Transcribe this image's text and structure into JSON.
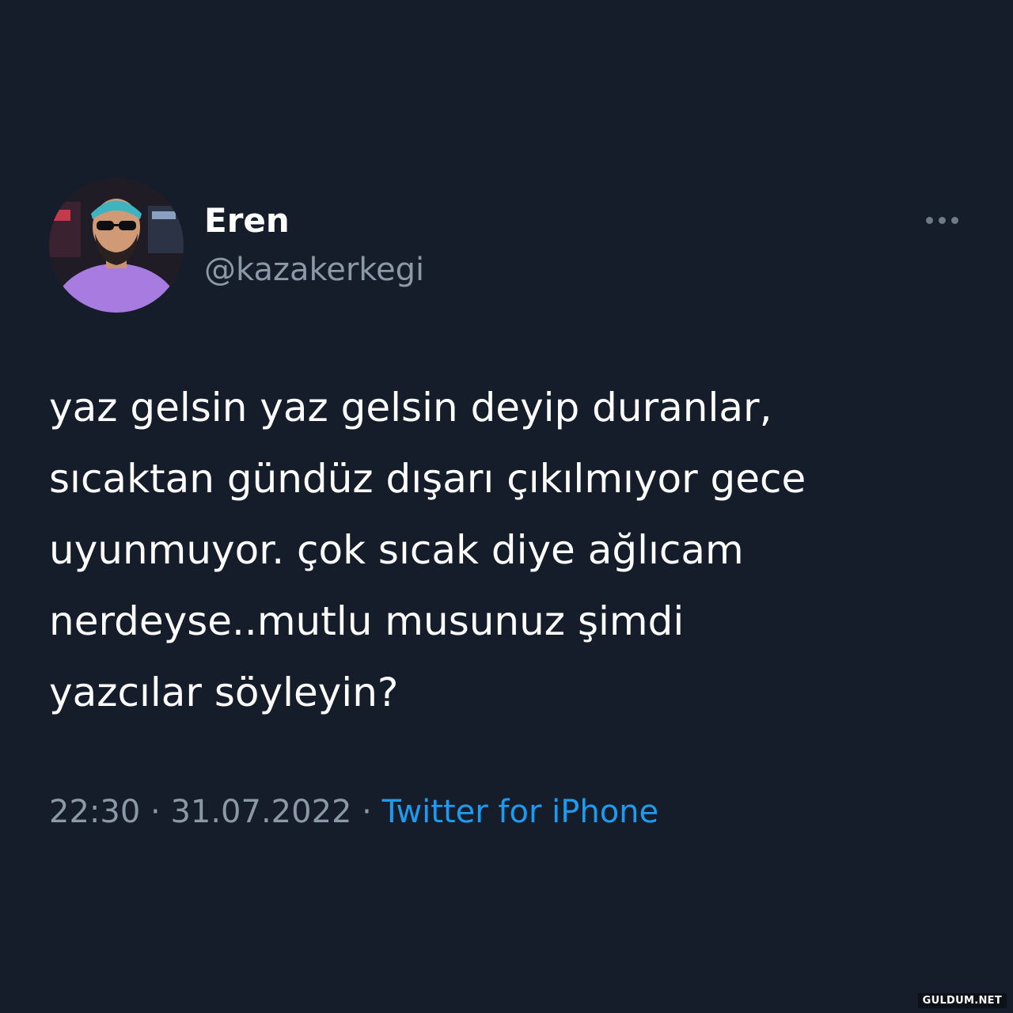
{
  "author": {
    "display_name": "Eren",
    "handle": "@kazakerkegi",
    "avatar_icon": "profile-photo"
  },
  "more_icon": "more-horizontal-icon",
  "tweet": {
    "lines": [
      "yaz gelsin yaz gelsin deyip duranlar,",
      "sıcaktan gündüz dışarı çıkılmıyor gece",
      "uyunmuyor. çok sıcak diye ağlıcam",
      "nerdeyse..mutlu musunuz şimdi",
      "yazcılar söyleyin?"
    ]
  },
  "meta": {
    "time": "22:30",
    "separator": " · ",
    "date": "31.07.2022",
    "source": "Twitter for iPhone"
  },
  "watermark": "GULDUM.NET",
  "colors": {
    "background": "#161d2a",
    "text": "#ffffff",
    "secondary": "#8b98a5",
    "link": "#1d9bf0"
  }
}
